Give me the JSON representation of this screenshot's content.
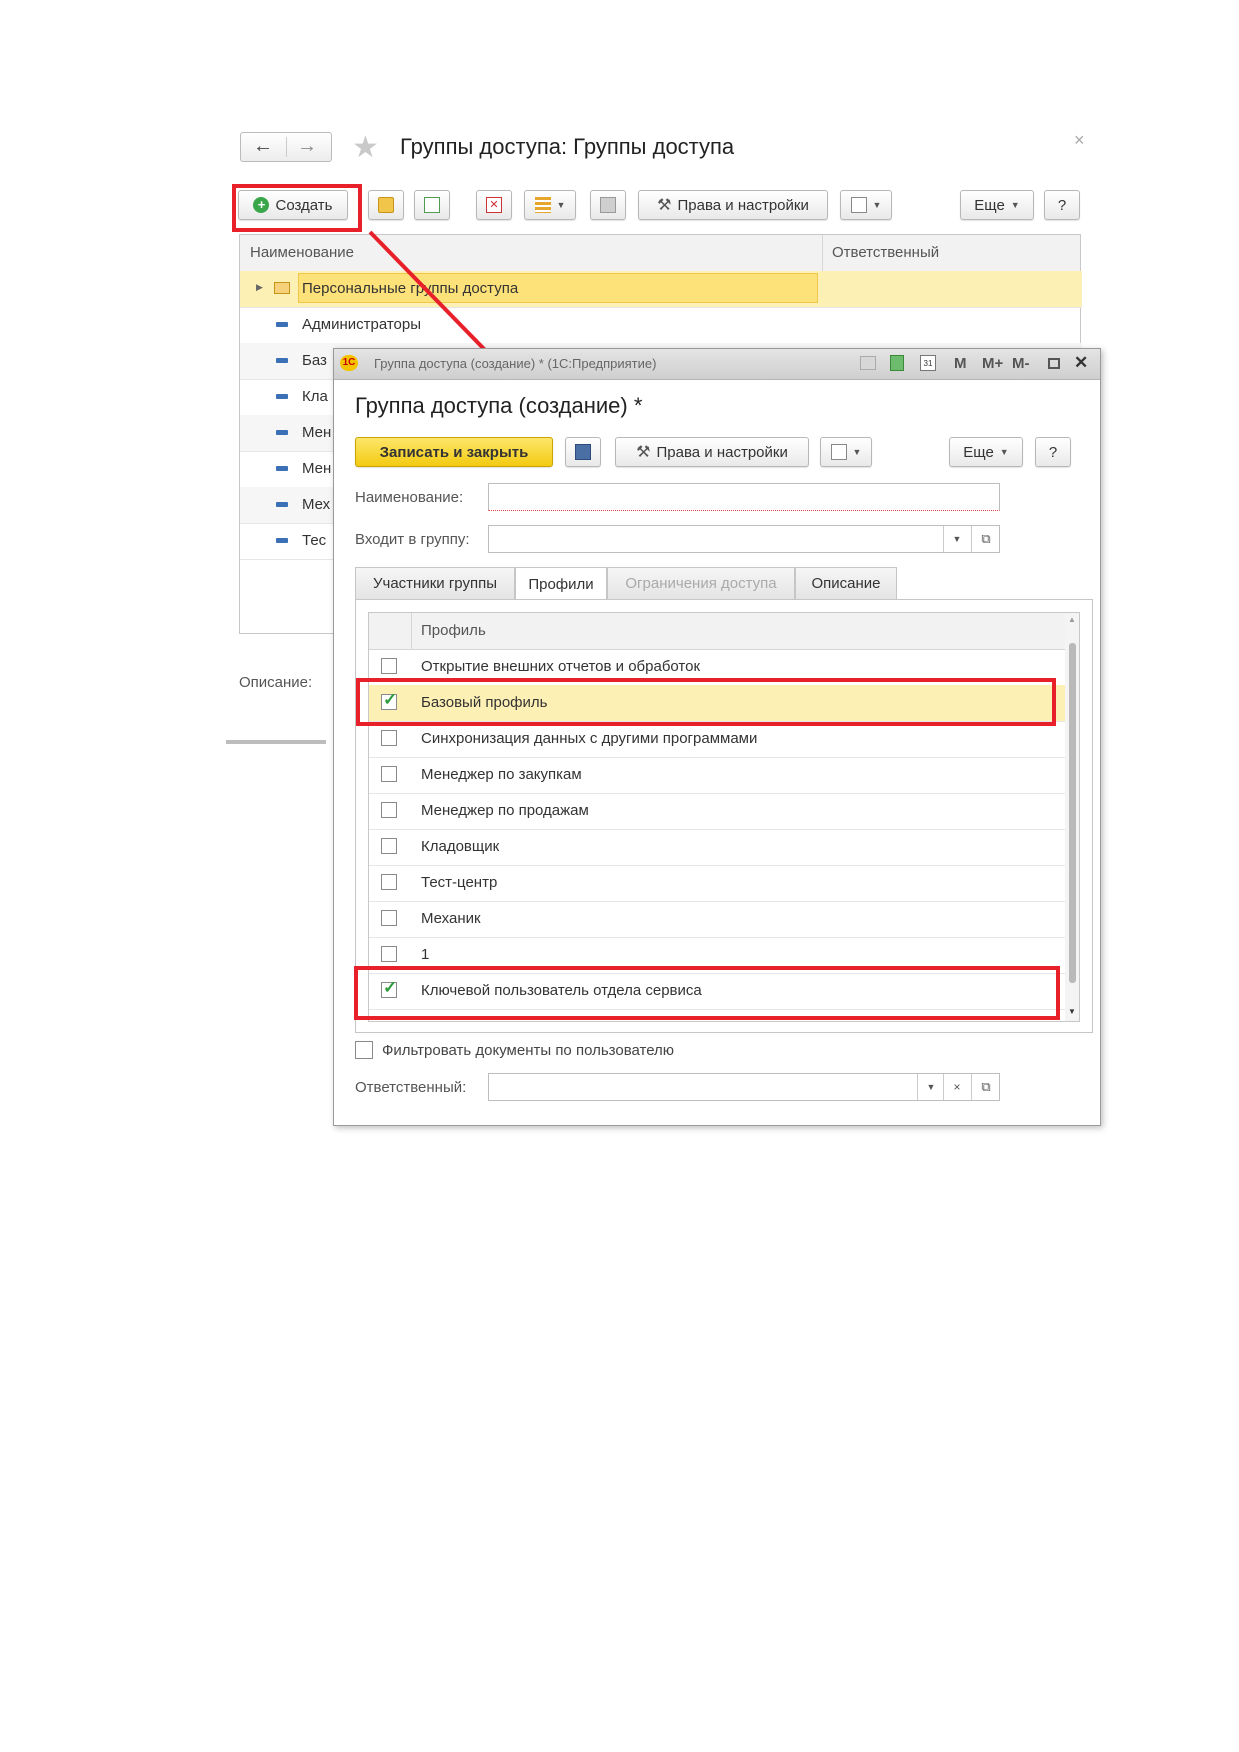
{
  "back_window": {
    "title": "Группы доступа: Группы доступа",
    "close_glyph": "×",
    "toolbar": {
      "create_label": "Создать",
      "rights_label": "Права и настройки",
      "more_label": "Еще",
      "help_label": "?"
    },
    "columns": {
      "name": "Наименование",
      "responsible": "Ответственный"
    },
    "rows": [
      {
        "label": "Персональные группы доступа",
        "kind": "folder"
      },
      {
        "label": "Администраторы",
        "kind": "item"
      },
      {
        "label": "Баз",
        "kind": "item"
      },
      {
        "label": "Кла",
        "kind": "item"
      },
      {
        "label": "Мен",
        "kind": "item"
      },
      {
        "label": "Мен",
        "kind": "item"
      },
      {
        "label": "Мех",
        "kind": "item"
      },
      {
        "label": "Тес",
        "kind": "item"
      }
    ],
    "description_label": "Описание:"
  },
  "front_window": {
    "titlebar": "Группа доступа (создание) * (1С:Предприятие)",
    "titlebar_buttons": {
      "m": "M",
      "mplus": "M+",
      "mminus": "M-",
      "close": "✕"
    },
    "heading": "Группа доступа (создание) *",
    "toolbar": {
      "save_close_label": "Записать и закрыть",
      "rights_label": "Права и настройки",
      "more_label": "Еще",
      "help_label": "?"
    },
    "name_label": "Наименование:",
    "group_label": "Входит в группу:",
    "tabs": [
      {
        "label": "Участники группы",
        "state": "normal"
      },
      {
        "label": "Профили",
        "state": "active"
      },
      {
        "label": "Ограничения доступа",
        "state": "disabled"
      },
      {
        "label": "Описание",
        "state": "normal"
      }
    ],
    "profile_header": "Профиль",
    "profiles": [
      {
        "label": "Открытие внешних отчетов и обработок",
        "checked": false
      },
      {
        "label": "Базовый профиль",
        "checked": true
      },
      {
        "label": "Синхронизация данных с другими программами",
        "checked": false
      },
      {
        "label": "Менеджер по закупкам",
        "checked": false
      },
      {
        "label": "Менеджер по продажам",
        "checked": false
      },
      {
        "label": "Кладовщик",
        "checked": false
      },
      {
        "label": "Тест-центр",
        "checked": false
      },
      {
        "label": "Механик",
        "checked": false
      },
      {
        "label": "1",
        "checked": false
      },
      {
        "label": "Ключевой пользователь отдела сервиса",
        "checked": true
      }
    ],
    "filter_label": "Фильтровать документы по пользователю",
    "responsible_label": "Ответственный:"
  },
  "colors": {
    "highlight_red": "#e8202a",
    "selection_yellow": "#fdf0b4",
    "yellow_button": "#f9d71c",
    "check_green": "#2e9b3e"
  }
}
